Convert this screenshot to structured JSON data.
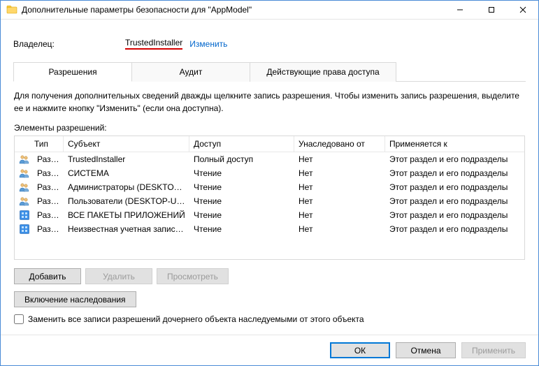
{
  "window": {
    "title": "Дополнительные параметры безопасности  для \"AppModel\""
  },
  "owner": {
    "label": "Владелец:",
    "name": "TrustedInstaller",
    "change": "Изменить"
  },
  "tabs": {
    "permissions": "Разрешения",
    "audit": "Аудит",
    "effective": "Действующие права доступа"
  },
  "description": "Для получения дополнительных сведений дважды щелкните запись разрешения. Чтобы изменить запись разрешения, выделите ее и нажмите кнопку \"Изменить\" (если она доступна).",
  "list_label": "Элементы разрешений:",
  "headers": {
    "type": "Тип",
    "subject": "Субъект",
    "access": "Доступ",
    "inherited": "Унаследовано от",
    "applies": "Применяется к"
  },
  "rows": [
    {
      "icon": "group",
      "type": "Разр...",
      "subject": "TrustedInstaller",
      "access": "Полный доступ",
      "inherited": "Нет",
      "applies": "Этот раздел и его подразделы"
    },
    {
      "icon": "group",
      "type": "Разр...",
      "subject": "СИСТЕМА",
      "access": "Чтение",
      "inherited": "Нет",
      "applies": "Этот раздел и его подразделы"
    },
    {
      "icon": "group",
      "type": "Разр...",
      "subject": "Администраторы (DESKTOP-...",
      "access": "Чтение",
      "inherited": "Нет",
      "applies": "Этот раздел и его подразделы"
    },
    {
      "icon": "group",
      "type": "Разр...",
      "subject": "Пользователи (DESKTOP-UG...",
      "access": "Чтение",
      "inherited": "Нет",
      "applies": "Этот раздел и его подразделы"
    },
    {
      "icon": "app",
      "type": "Разр...",
      "subject": "ВСЕ ПАКЕТЫ ПРИЛОЖЕНИЙ",
      "access": "Чтение",
      "inherited": "Нет",
      "applies": "Этот раздел и его подразделы"
    },
    {
      "icon": "app",
      "type": "Разр...",
      "subject": "Неизвестная учетная запись...",
      "access": "Чтение",
      "inherited": "Нет",
      "applies": "Этот раздел и его подразделы"
    }
  ],
  "buttons": {
    "add": "Добавить",
    "remove": "Удалить",
    "view": "Просмотреть",
    "inherit": "Включение наследования"
  },
  "checkbox": {
    "label": "Заменить все записи разрешений дочернего объекта наследуемыми от этого объекта"
  },
  "footer": {
    "ok": "ОК",
    "cancel": "Отмена",
    "apply": "Применить"
  }
}
